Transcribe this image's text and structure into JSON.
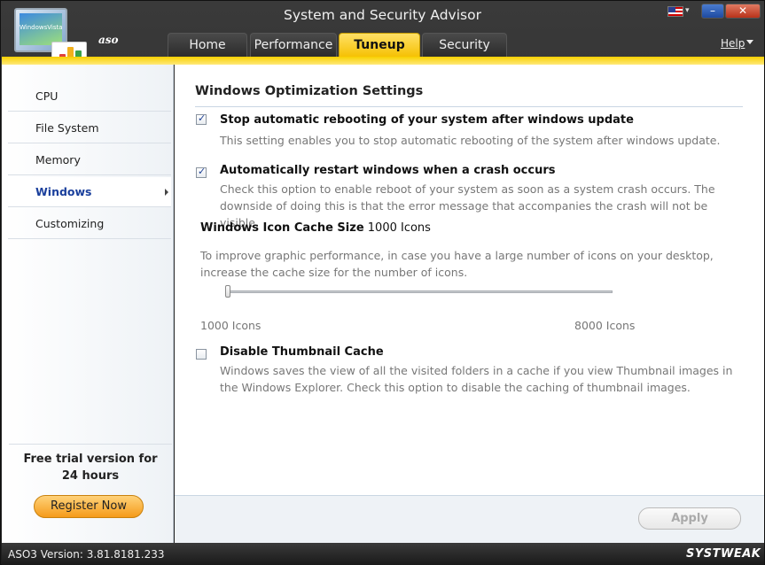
{
  "window": {
    "title": "System and Security Advisor",
    "logo_text": "WindowsVista",
    "brand_small": "aso"
  },
  "tabs": [
    {
      "label": "Home",
      "active": false
    },
    {
      "label": "Performance",
      "active": false
    },
    {
      "label": "Tuneup",
      "active": true
    },
    {
      "label": "Security",
      "active": false
    }
  ],
  "help": {
    "label": "Help"
  },
  "sidebar": {
    "items": [
      {
        "label": "CPU"
      },
      {
        "label": "File System"
      },
      {
        "label": "Memory"
      },
      {
        "label": "Windows",
        "active": true
      },
      {
        "label": "Customizing"
      }
    ],
    "trial_text_line1": "Free trial version for",
    "trial_text_line2": "24 hours",
    "register_label": "Register Now"
  },
  "content": {
    "title": "Windows Optimization Settings",
    "options": [
      {
        "title": "Stop automatic rebooting of your system after windows update",
        "desc": "This setting enables you to stop automatic rebooting of the system after windows update.",
        "checked": true
      },
      {
        "title": "Automatically restart windows when a crash occurs",
        "desc": "Check this option to enable reboot of your system as soon as a system crash occurs. The downside of doing this is that the error message that accompanies the crash will not be visible.",
        "checked": true
      },
      {
        "title": "Disable Thumbnail Cache",
        "desc": "Windows saves the view of all the visited folders in a cache if you view Thumbnail images in the Windows Explorer. Check this option to disable the caching of thumbnail images.",
        "checked": false
      }
    ],
    "cache": {
      "label": "Windows Icon Cache Size",
      "value": "1000 Icons",
      "desc": "To improve graphic performance, in case you have a large number of icons on your desktop, increase the cache size for the number of icons.",
      "min_label": "1000 Icons",
      "max_label": "8000 Icons"
    },
    "apply_label": "Apply"
  },
  "status": {
    "version": "ASO3 Version: 3.81.8181.233",
    "brand": "SYSTWEAK"
  },
  "colors": {
    "accent": "#f5c000",
    "active_nav": "#1a3f9c",
    "register": "#f59b1a"
  }
}
